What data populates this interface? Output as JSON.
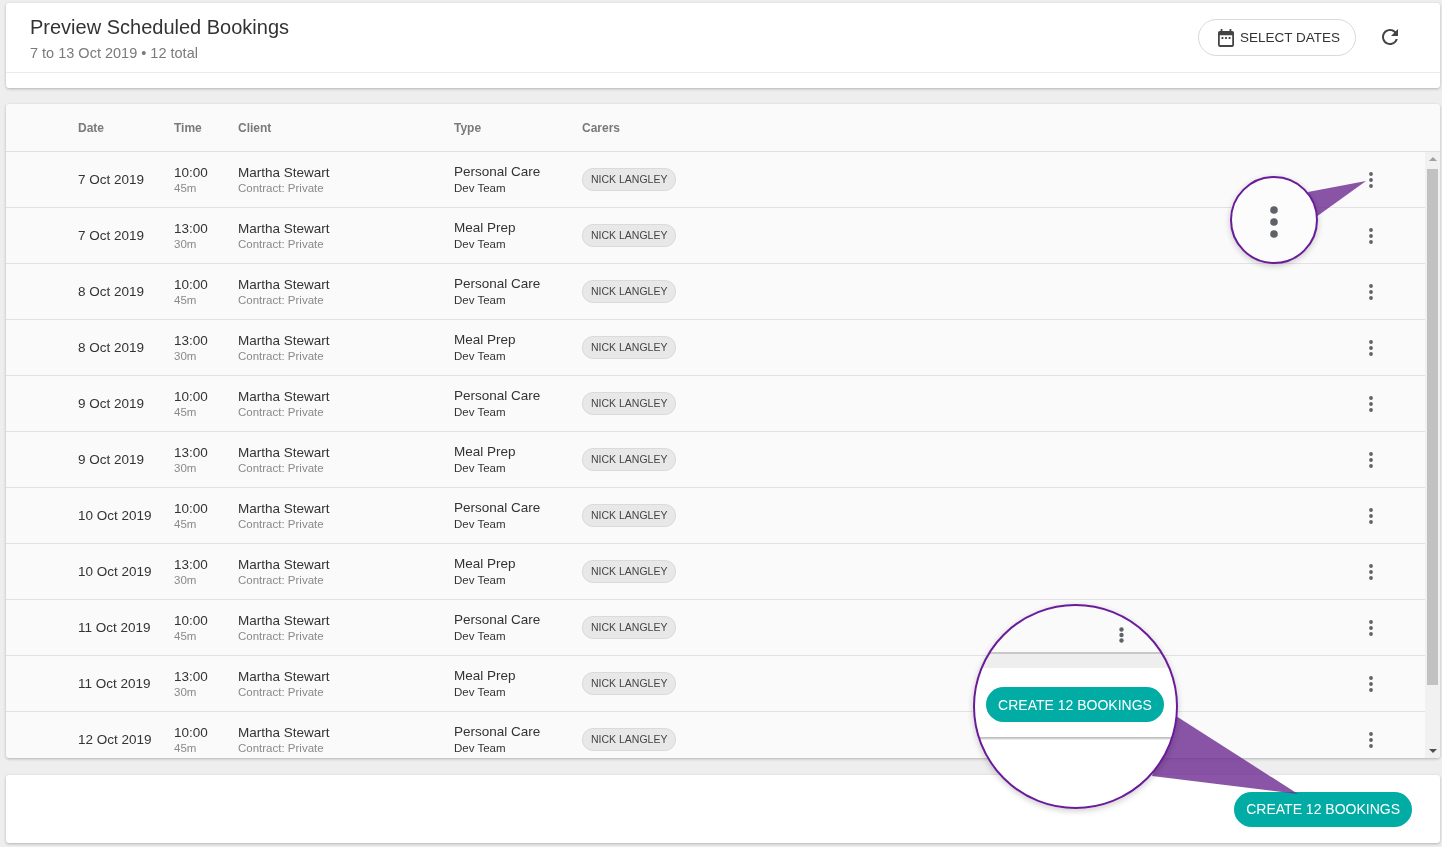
{
  "header": {
    "title": "Preview Scheduled Bookings",
    "subtitle": "7 to 13 Oct 2019 • 12 total",
    "select_dates_button": "SELECT DATES"
  },
  "table": {
    "columns": [
      "Date",
      "Time",
      "Client",
      "Type",
      "Carers"
    ],
    "rows": [
      {
        "date": "7 Oct 2019",
        "time": "10:00",
        "duration": "45m",
        "client": "Martha Stewart",
        "contract": "Contract: Private",
        "type": "Personal Care",
        "team": "Dev Team",
        "carers": [
          "NICK LANGLEY"
        ]
      },
      {
        "date": "7 Oct 2019",
        "time": "13:00",
        "duration": "30m",
        "client": "Martha Stewart",
        "contract": "Contract: Private",
        "type": "Meal Prep",
        "team": "Dev Team",
        "carers": [
          "NICK LANGLEY"
        ]
      },
      {
        "date": "8 Oct 2019",
        "time": "10:00",
        "duration": "45m",
        "client": "Martha Stewart",
        "contract": "Contract: Private",
        "type": "Personal Care",
        "team": "Dev Team",
        "carers": [
          "NICK LANGLEY"
        ]
      },
      {
        "date": "8 Oct 2019",
        "time": "13:00",
        "duration": "30m",
        "client": "Martha Stewart",
        "contract": "Contract: Private",
        "type": "Meal Prep",
        "team": "Dev Team",
        "carers": [
          "NICK LANGLEY"
        ]
      },
      {
        "date": "9 Oct 2019",
        "time": "10:00",
        "duration": "45m",
        "client": "Martha Stewart",
        "contract": "Contract: Private",
        "type": "Personal Care",
        "team": "Dev Team",
        "carers": [
          "NICK LANGLEY"
        ]
      },
      {
        "date": "9 Oct 2019",
        "time": "13:00",
        "duration": "30m",
        "client": "Martha Stewart",
        "contract": "Contract: Private",
        "type": "Meal Prep",
        "team": "Dev Team",
        "carers": [
          "NICK LANGLEY"
        ]
      },
      {
        "date": "10 Oct 2019",
        "time": "10:00",
        "duration": "45m",
        "client": "Martha Stewart",
        "contract": "Contract: Private",
        "type": "Personal Care",
        "team": "Dev Team",
        "carers": [
          "NICK LANGLEY"
        ]
      },
      {
        "date": "10 Oct 2019",
        "time": "13:00",
        "duration": "30m",
        "client": "Martha Stewart",
        "contract": "Contract: Private",
        "type": "Meal Prep",
        "team": "Dev Team",
        "carers": [
          "NICK LANGLEY"
        ]
      },
      {
        "date": "11 Oct 2019",
        "time": "10:00",
        "duration": "45m",
        "client": "Martha Stewart",
        "contract": "Contract: Private",
        "type": "Personal Care",
        "team": "Dev Team",
        "carers": [
          "NICK LANGLEY"
        ]
      },
      {
        "date": "11 Oct 2019",
        "time": "13:00",
        "duration": "30m",
        "client": "Martha Stewart",
        "contract": "Contract: Private",
        "type": "Meal Prep",
        "team": "Dev Team",
        "carers": [
          "NICK LANGLEY"
        ]
      },
      {
        "date": "12 Oct 2019",
        "time": "10:00",
        "duration": "45m",
        "client": "Martha Stewart",
        "contract": "Contract: Private",
        "type": "Personal Care",
        "team": "Dev Team",
        "carers": [
          "NICK LANGLEY"
        ]
      }
    ]
  },
  "footer": {
    "create_button": "CREATE 12 BOOKINGS"
  },
  "callouts": [
    {
      "kind": "row-menu"
    },
    {
      "kind": "create-button",
      "button_label": "CREATE 12 BOOKINGS"
    }
  ]
}
